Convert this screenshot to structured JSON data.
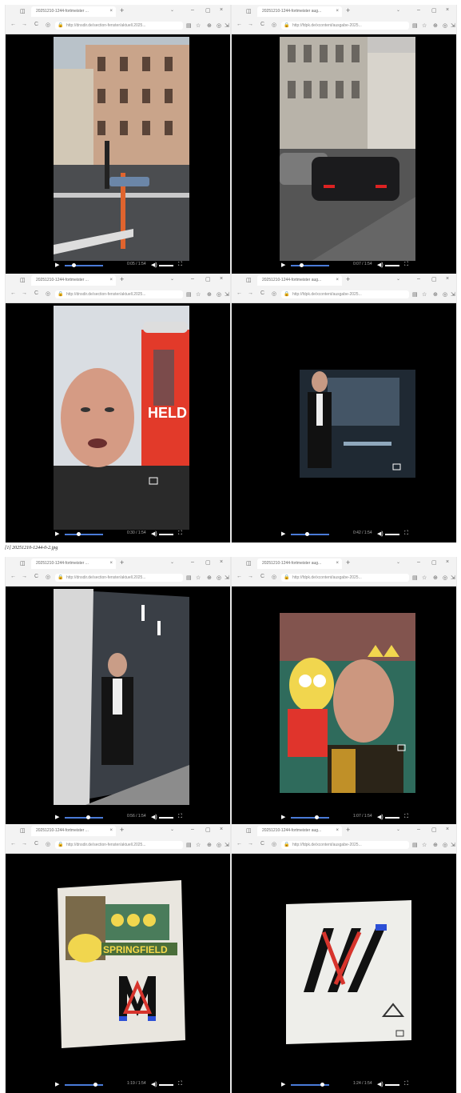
{
  "caption": "[1] 20251210-1244-0-2.jpg",
  "browser": {
    "tab_icon": "◫",
    "tab_title_a": "20251210-1244-fortmeister ...",
    "tab_title_b": "20251210-1244-fortmeister aug...",
    "url_a": "http://dnsdir.de/section-fenster/aktuell.2025...",
    "url_b": "http://fdpk.de/xcontent/ausgabe-2025...",
    "new_tab": "+",
    "close_tab": "×",
    "chevron": "⌄",
    "minimize": "–",
    "maximize": "▢",
    "close": "×",
    "back": "←",
    "forward": "→",
    "reload": "C",
    "lock": "🔒",
    "shield": "◎",
    "star": "☆",
    "reader": "▤",
    "ext": "⊕",
    "profile": "◎",
    "menu": "⇲"
  },
  "player": {
    "play": "▶",
    "volume": "◀)",
    "fullscreen": "⛶"
  },
  "panels": [
    {
      "time": "0:05 / 1:54",
      "progress": 0.18,
      "scene": "street-buildings"
    },
    {
      "time": "0:07 / 1:54",
      "progress": 0.22,
      "scene": "parked-cars"
    },
    {
      "time": "0:30 / 1:54",
      "progress": 0.32,
      "scene": "selfie-poster"
    },
    {
      "time": "0:42 / 1:54",
      "progress": 0.38,
      "scene": "man-in-suit-dark"
    },
    {
      "time": "0:56 / 1:54",
      "progress": 0.56,
      "scene": "man-in-suit-tunnel"
    },
    {
      "time": "1:07 / 1:54",
      "progress": 0.62,
      "scene": "selfie-homer"
    },
    {
      "time": "1:19 / 1:54",
      "progress": 0.74,
      "scene": "springfield-poster"
    },
    {
      "time": "1:24 / 1:54",
      "progress": 0.78,
      "scene": "wa-sign"
    }
  ],
  "poster_text": "HELD",
  "springfield_text": "SPRINGFIELD"
}
